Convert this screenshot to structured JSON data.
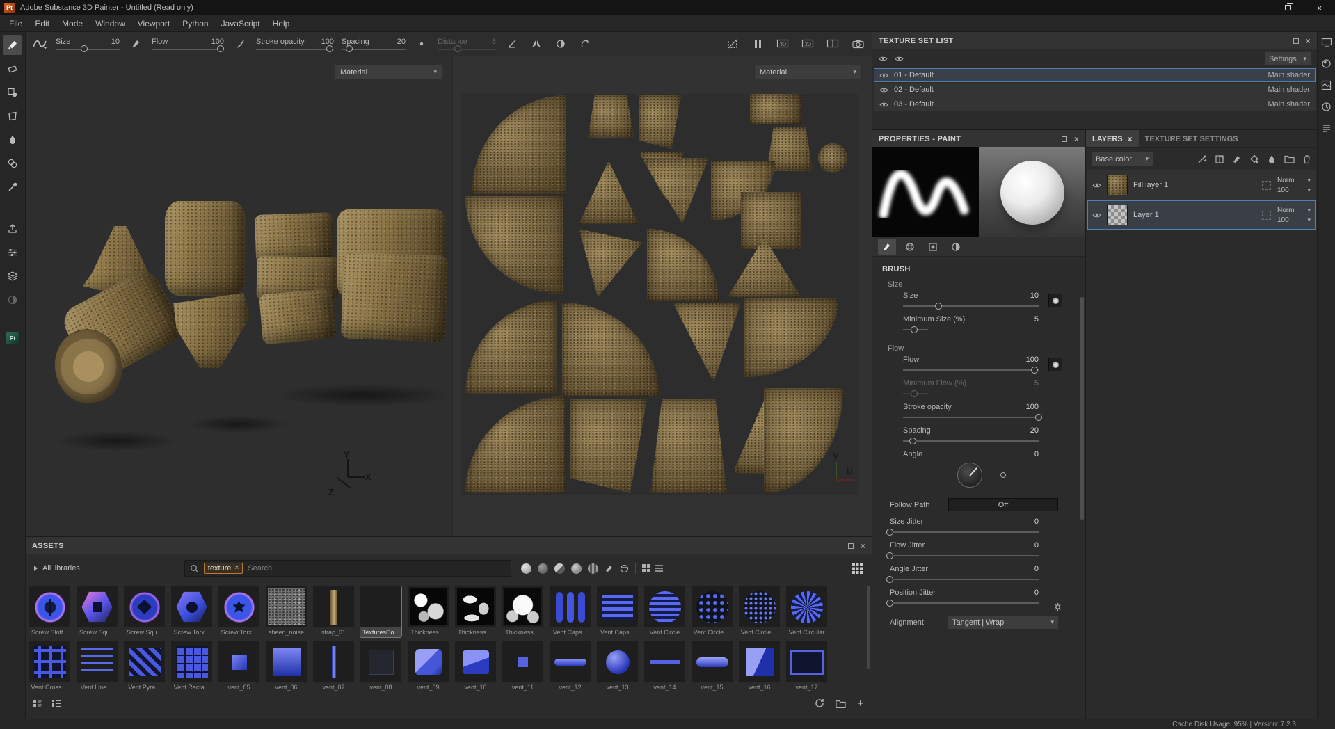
{
  "window": {
    "logo": "Pt",
    "title": "Adobe Substance 3D Painter - Untitled (Read only)"
  },
  "menu": [
    "File",
    "Edit",
    "Mode",
    "Window",
    "Viewport",
    "Python",
    "JavaScript",
    "Help"
  ],
  "toolbar": {
    "size": {
      "label": "Size",
      "value": "10",
      "pct": 45
    },
    "flow": {
      "label": "Flow",
      "value": "100",
      "pct": 95
    },
    "stroke_opacity": {
      "label": "Stroke opacity",
      "value": "100",
      "pct": 95
    },
    "spacing": {
      "label": "Spacing",
      "value": "20",
      "pct": 12
    },
    "distance": {
      "label": "Distance",
      "value": "8",
      "pct": 35
    }
  },
  "viewport3d": {
    "material": "Material",
    "axis_x": "X",
    "axis_y": "Y",
    "axis_z": "Z"
  },
  "viewport2d": {
    "material": "Material",
    "axis_u": "U",
    "axis_v": "V"
  },
  "texture_set_list": {
    "title": "TEXTURE SET LIST",
    "settings": "Settings",
    "items": [
      {
        "name": "01 - Default",
        "shader": "Main shader",
        "selected": true
      },
      {
        "name": "02 - Default",
        "shader": "Main shader",
        "selected": false
      },
      {
        "name": "03 - Default",
        "shader": "Main shader",
        "selected": false
      }
    ]
  },
  "properties": {
    "title": "PROPERTIES - PAINT",
    "section_title": "BRUSH",
    "controls": [
      {
        "kind": "section",
        "label": "Size"
      },
      {
        "kind": "slider",
        "label": "Size",
        "value": "10",
        "pct": 26,
        "tip": true
      },
      {
        "kind": "mini",
        "label": "Minimum Size (%)",
        "value": "5",
        "pct": 45
      },
      {
        "kind": "section",
        "label": "Flow"
      },
      {
        "kind": "slider",
        "label": "Flow",
        "value": "100",
        "pct": 97,
        "tip": true
      },
      {
        "kind": "mini",
        "label": "Minimum Flow (%)",
        "value": "5",
        "pct": 45,
        "disabled": true
      },
      {
        "kind": "slider",
        "label": "Stroke opacity",
        "value": "100",
        "pct": 100
      },
      {
        "kind": "slider",
        "label": "Spacing",
        "value": "20",
        "pct": 7
      },
      {
        "kind": "angle",
        "label": "Angle",
        "value": "0"
      },
      {
        "kind": "button",
        "label": "Follow Path",
        "value": "Off",
        "outer": true
      },
      {
        "kind": "slider",
        "label": "Size Jitter",
        "value": "0",
        "pct": 0,
        "outer": true
      },
      {
        "kind": "slider",
        "label": "Flow Jitter",
        "value": "0",
        "pct": 0,
        "outer": true
      },
      {
        "kind": "slider",
        "label": "Angle Jitter",
        "value": "0",
        "pct": 0,
        "outer": true
      },
      {
        "kind": "slider",
        "label": "Position Jitter",
        "value": "0",
        "pct": 0,
        "outer": true,
        "gear": true
      },
      {
        "kind": "dropdown",
        "label": "Alignment",
        "value": "Tangent | Wrap",
        "outer": true
      }
    ]
  },
  "layers": {
    "tabs": [
      "LAYERS",
      "TEXTURE SET SETTINGS"
    ],
    "channel": "Base color",
    "items": [
      {
        "name": "Fill layer 1",
        "blend": "Norm",
        "opacity": "100",
        "thumb": "cork",
        "selected": false
      },
      {
        "name": "Layer 1",
        "blend": "Norm",
        "opacity": "100",
        "thumb": "checker",
        "selected": true
      }
    ]
  },
  "assets": {
    "title": "ASSETS",
    "libraries": "All libraries",
    "tag": "texture",
    "placeholder": "Search",
    "row1": [
      {
        "name": "Screw Slott...",
        "type": "screw1"
      },
      {
        "name": "Screw Squ...",
        "type": "screw2"
      },
      {
        "name": "Screw Squ...",
        "type": "screw3"
      },
      {
        "name": "Screw Torx...",
        "type": "screw4"
      },
      {
        "name": "Screw Torx...",
        "type": "screw5"
      },
      {
        "name": "sheen_noise",
        "type": "noise"
      },
      {
        "name": "strap_01",
        "type": "strap"
      },
      {
        "name": "TexturesCo...",
        "type": "cork",
        "selected": true
      },
      {
        "name": "Thickness ...",
        "type": "thick1"
      },
      {
        "name": "Thickness ...",
        "type": "thick2"
      },
      {
        "name": "Thickness ...",
        "type": "thick3"
      },
      {
        "name": "Vent Caps...",
        "type": "ventvbars"
      },
      {
        "name": "Vent Caps...",
        "type": "venthbars"
      },
      {
        "name": "Vent Circle",
        "type": "ventcirclestripes"
      },
      {
        "name": "Vent Circle ...",
        "type": "ventdotring"
      },
      {
        "name": "Vent Circle ...",
        "type": "ventdotgrid"
      },
      {
        "name": "Vent Circular",
        "type": "ventfan"
      }
    ],
    "row2": [
      {
        "name": "Vent Cross ...",
        "type": "ventcross"
      },
      {
        "name": "Vent Line ...",
        "type": "ventdash"
      },
      {
        "name": "Vent Pyra...",
        "type": "venttri"
      },
      {
        "name": "Vent Recta...",
        "type": "ventgrid"
      },
      {
        "name": "vent_05",
        "type": "sqsmall"
      },
      {
        "name": "vent_06",
        "type": "sqbig"
      },
      {
        "name": "vent_07",
        "type": "vbarthin"
      },
      {
        "name": "vent_08",
        "type": "sqdark"
      },
      {
        "name": "vent_09",
        "type": "cube"
      },
      {
        "name": "vent_10",
        "type": "cube2"
      },
      {
        "name": "vent_11",
        "type": "sqtiny"
      },
      {
        "name": "vent_12",
        "type": "hbar"
      },
      {
        "name": "vent_13",
        "type": "disc"
      },
      {
        "name": "vent_14",
        "type": "hbarthin"
      },
      {
        "name": "vent_15",
        "type": "capsule"
      },
      {
        "name": "vent_16",
        "type": "duotone"
      },
      {
        "name": "vent_17",
        "type": "rectoutline"
      }
    ]
  },
  "status": "Cache Disk Usage:  95% | Version: 7.2.3"
}
